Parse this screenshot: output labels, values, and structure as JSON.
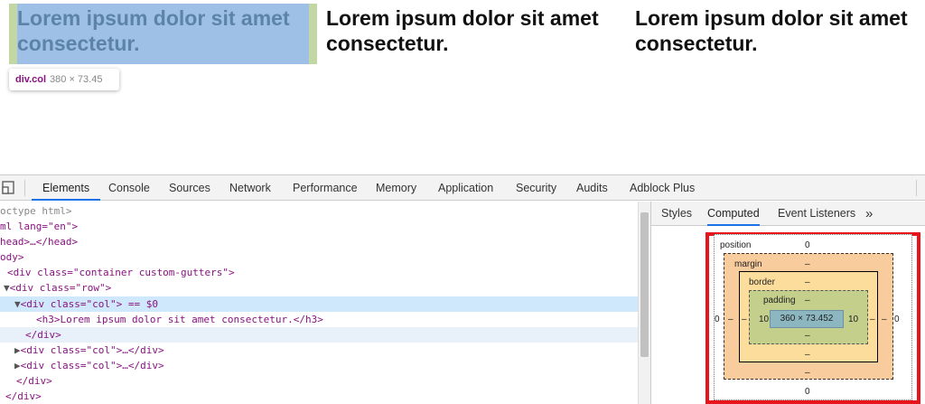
{
  "page": {
    "columns": [
      {
        "heading": "Lorem ipsum dolor sit amet\nconsectetur."
      },
      {
        "heading": "Lorem ipsum dolor sit amet\nconsectetur."
      },
      {
        "heading": "Lorem ipsum dolor sit amet\nconsectetur."
      }
    ],
    "tooltip": {
      "tag": "div.col",
      "dims": "380 × 73.45"
    }
  },
  "devtools": {
    "tabs": [
      "Elements",
      "Console",
      "Sources",
      "Network",
      "Performance",
      "Memory",
      "Application",
      "Security",
      "Audits",
      "Adblock Plus"
    ],
    "active_tab": "Elements",
    "dom_lines": [
      {
        "text": "octype html>"
      },
      {
        "text": "ml lang=\"en\">"
      },
      {
        "text": "head>…</head>"
      },
      {
        "text": "ody>"
      },
      {
        "text": "<div class=\"container custom-gutters\">"
      },
      {
        "text": "<div class=\"row\">"
      },
      {
        "text": "<div class=\"col\"> == $0"
      },
      {
        "text": "<h3>Lorem ipsum dolor sit amet consectetur.</h3>"
      },
      {
        "text": "</div>"
      },
      {
        "text": "<div class=\"col\">…</div>"
      },
      {
        "text": "<div class=\"col\">…</div>"
      },
      {
        "text": "</div>"
      },
      {
        "text": "</div>"
      }
    ],
    "sidebar": {
      "tabs": [
        "Styles",
        "Computed",
        "Event Listeners"
      ],
      "active_tab": "Computed",
      "more_label": "»",
      "box_model": {
        "position_label": "position",
        "position_top": "0",
        "position_left": "0",
        "position_right": "0",
        "position_bottom": "0",
        "margin_label": "margin",
        "margin_top": "–",
        "margin_left": "–",
        "margin_right": "–",
        "margin_bottom": "–",
        "border_label": "border",
        "border_top": "–",
        "border_left": "–",
        "border_right": "–",
        "border_bottom": "–",
        "padding_label": "padding",
        "padding_top": "–",
        "padding_left": "10",
        "padding_right": "10",
        "padding_bottom": "–",
        "content": "360 × 73.452"
      }
    }
  },
  "colors": {
    "highlight_padding": "#c3d7a4",
    "highlight_content": "#9fc0e6",
    "selected_row": "#cfe8fc",
    "active_tab_underline": "#1a73e8",
    "annotation_frame": "#e8141c"
  }
}
